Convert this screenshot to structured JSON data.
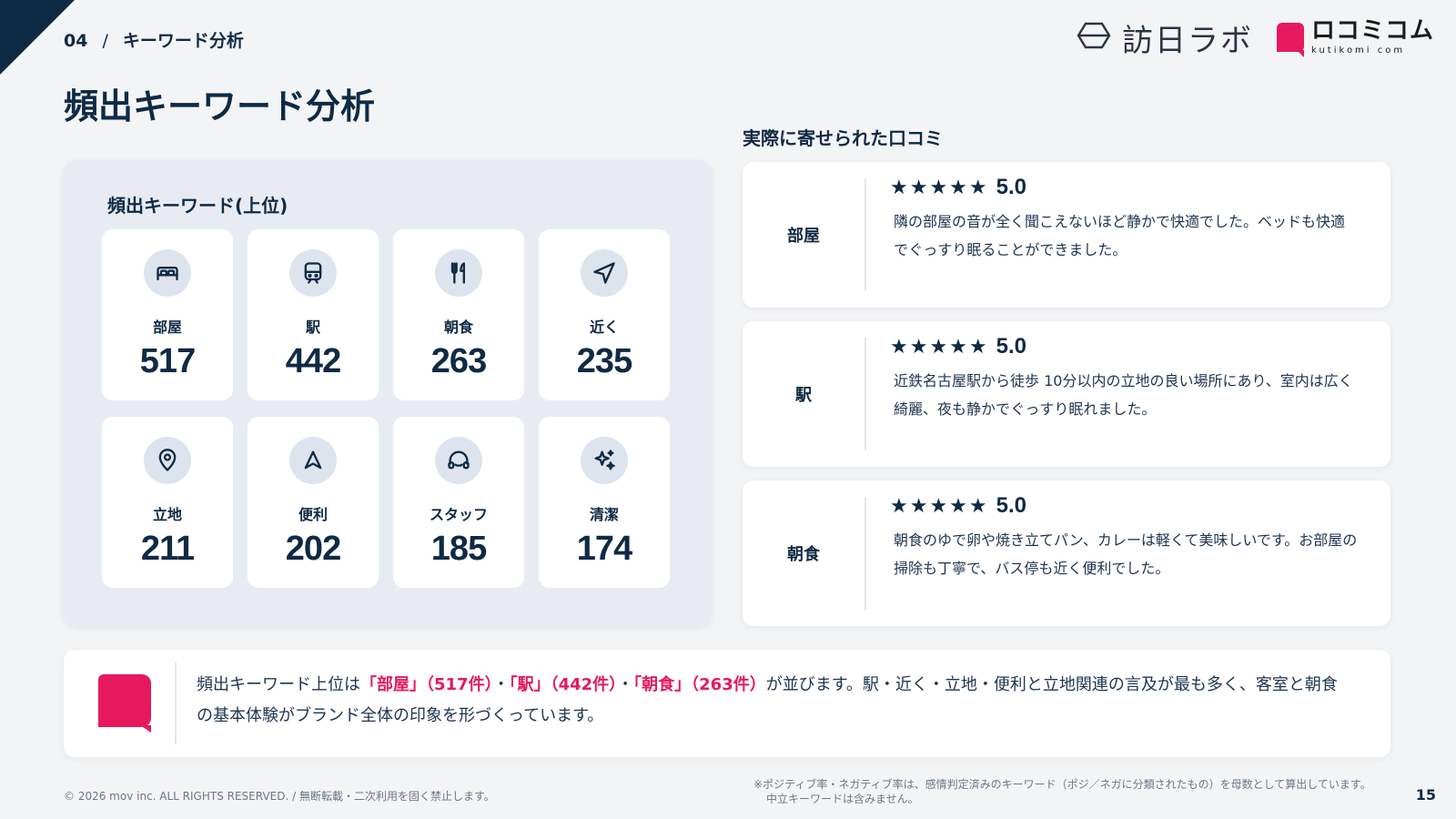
{
  "header": {
    "section_number": "04",
    "separator": "/",
    "section_title": "キーワード分析",
    "brand_logo_text": "訪日ラボ",
    "partner_logo_text": "ロコミコム",
    "partner_logo_sub": "kutikomi com"
  },
  "page_title": "頻出キーワード分析",
  "keywords_panel": {
    "title": "頻出キーワード(上位)",
    "items": [
      {
        "label": "部屋",
        "count": "517",
        "icon": "bed-icon"
      },
      {
        "label": "駅",
        "count": "442",
        "icon": "train-icon"
      },
      {
        "label": "朝食",
        "count": "263",
        "icon": "utensils-icon"
      },
      {
        "label": "近く",
        "count": "235",
        "icon": "navigation-arrow-icon"
      },
      {
        "label": "立地",
        "count": "211",
        "icon": "location-pin-icon"
      },
      {
        "label": "便利",
        "count": "202",
        "icon": "send-arrow-icon"
      },
      {
        "label": "スタッフ",
        "count": "185",
        "icon": "headset-icon"
      },
      {
        "label": "清潔",
        "count": "174",
        "icon": "sparkles-icon"
      }
    ]
  },
  "reviews": {
    "heading": "実際に寄せられた口コミ",
    "items": [
      {
        "tag": "部屋",
        "stars": "★★★★★",
        "rating": "5.0",
        "text": "隣の部屋の音が全く聞こえないほど静かで快適でした。ベッドも快適でぐっすり眠ることができました。"
      },
      {
        "tag": "駅",
        "stars": "★★★★★",
        "rating": "5.0",
        "text": "近鉄名古屋駅から徒歩 10分以内の立地の良い場所にあり、室内は広く綺麗、夜も静かでぐっすり眠れました。"
      },
      {
        "tag": "朝食",
        "stars": "★★★★★",
        "rating": "5.0",
        "text": "朝食のゆで卵や焼き立てパン、カレーは軽くて美味しいです。お部屋の掃除も丁寧で、バス停も近く便利でした。"
      }
    ]
  },
  "summary": {
    "p1": "頻出キーワード上位は",
    "k1": "「部屋」",
    "c1": "（517件）",
    "sep1": "・",
    "k2": "「駅」",
    "c2": "（442件）",
    "sep2": "・",
    "k3": "「朝食」",
    "c3": "（263件）",
    "p2": "が並びます。駅・近く・立地・便利と立地関連の言及が最も多く、客室と朝食の基本体験がブランド全体の印象を形づくっています。"
  },
  "footer": {
    "copyright": "© 2026 mov inc. ALL RIGHTS RESERVED. / 無断転載・二次利用を固く禁止します。",
    "note_line1": "※ポジティブ率・ネガティブ率は、感情判定済みのキーワード（ポジ／ネガに分類されたもの）を母数として算出しています。",
    "note_line2": "中立キーワードは含みません。",
    "page_number": "15"
  },
  "colors": {
    "navy": "#0f2a44",
    "accent": "#e6195f",
    "panel": "#e8ecf2",
    "background": "#f3f4f6"
  }
}
